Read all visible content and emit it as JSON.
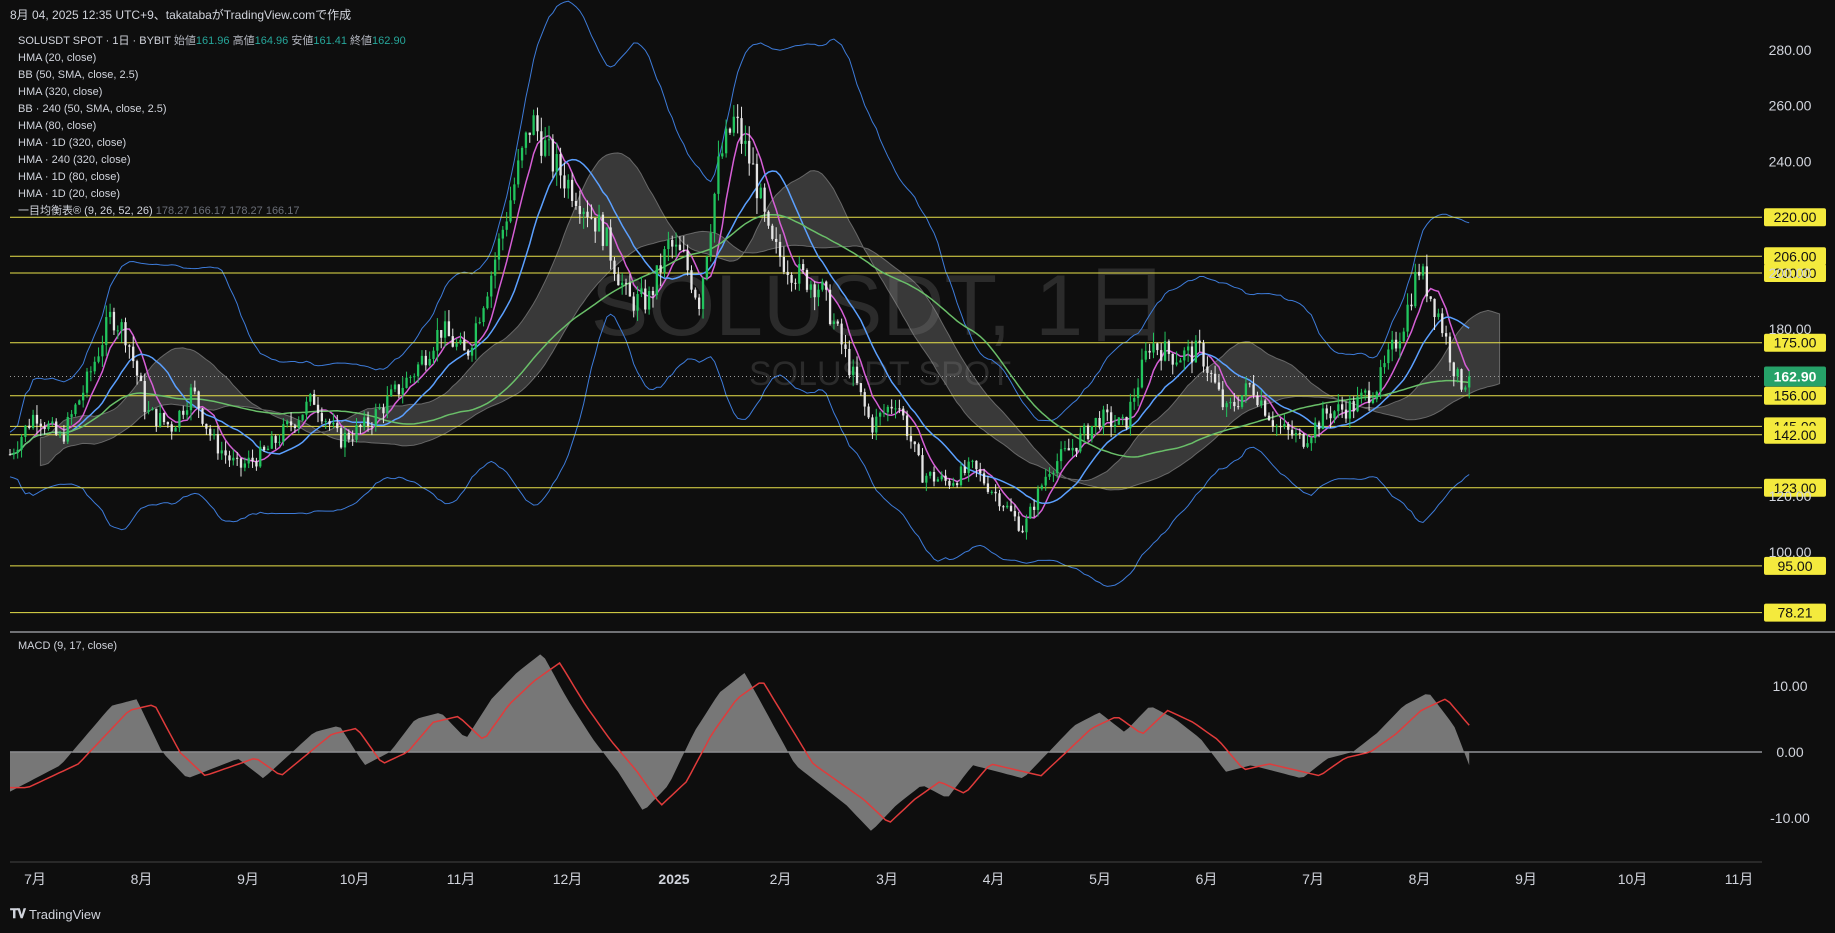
{
  "header": {
    "timestamp": "8月 04, 2025 12:35 UTC+9、takatabaがTradingView.comで作成"
  },
  "legend": {
    "symbol": "SOLUSDT SPOT · 1日 · BYBIT",
    "ohlc": [
      {
        "label": "始値",
        "value": "161.96"
      },
      {
        "label": "高値",
        "value": "164.96"
      },
      {
        "label": "安値",
        "value": "161.41"
      },
      {
        "label": "終値",
        "value": "162.90"
      }
    ],
    "indicators": [
      "HMA (20, close)",
      "BB (50, SMA, close, 2.5)",
      "HMA (320, close)",
      "BB · 240 (50, SMA, close, 2.5)",
      "HMA (80, close)",
      "HMA · 1D (320, close)",
      "HMA · 240 (320, close)",
      "HMA · 1D (80, close)",
      "HMA · 1D (20, close)"
    ],
    "ichimoku": {
      "name": "一目均衡表® (9, 26, 52, 26)",
      "values": [
        "178.27",
        "166.17",
        "178.27",
        "166.17"
      ]
    }
  },
  "watermark": {
    "title": "SOLUSDT, 1日",
    "subtitle": "SOLUSDT SPOT"
  },
  "macd_label": "MACD (9, 17, close)",
  "footer": {
    "brand": "TradingView",
    "logo": "tradingview-logo-icon"
  },
  "colors": {
    "background": "#0e0e0e",
    "up_candle": "#22c55e",
    "down_candle": "#e6e6e6",
    "level_line": "#e8e14a",
    "level_label_bg": "#f4ea3d",
    "price_label_bg": "#26a269",
    "hma_fast": "#d65fd6",
    "hma_mid": "#5ba0ff",
    "hma_slow": "#6abf69",
    "bb": "#3d7bd9",
    "cloud": "#8a8a8a",
    "macd_hist": "#8a8a8a",
    "macd_signal": "#e03b3b"
  },
  "chart_data": {
    "type": "candlestick",
    "title": "SOLUSDT, 1日",
    "price_axis_ticks": [
      "280.00",
      "260.00",
      "240.00",
      "200.00",
      "180.00",
      "120.00",
      "100.00"
    ],
    "ylim": [
      72,
      290
    ],
    "time_axis_labels": [
      "7月",
      "8月",
      "9月",
      "10月",
      "11月",
      "12月",
      "2025",
      "2月",
      "3月",
      "4月",
      "5月",
      "6月",
      "7月",
      "8月",
      "9月",
      "10月",
      "11月"
    ],
    "horizontal_levels": [
      "220.00",
      "206.00",
      "200.00",
      "175.00",
      "156.00",
      "145.00",
      "142.00",
      "123.00",
      "95.00",
      "78.21"
    ],
    "last_price": "162.90",
    "price_path": [
      {
        "x": 0,
        "p": 135
      },
      {
        "x": 0.5,
        "p": 150
      },
      {
        "x": 1,
        "p": 140
      },
      {
        "x": 1.5,
        "p": 160
      },
      {
        "x": 2,
        "p": 185
      },
      {
        "x": 2.3,
        "p": 178
      },
      {
        "x": 2.7,
        "p": 150
      },
      {
        "x": 3.2,
        "p": 145
      },
      {
        "x": 3.6,
        "p": 158
      },
      {
        "x": 4.0,
        "p": 140
      },
      {
        "x": 4.5,
        "p": 130
      },
      {
        "x": 5.0,
        "p": 135
      },
      {
        "x": 5.5,
        "p": 145
      },
      {
        "x": 6.0,
        "p": 155
      },
      {
        "x": 6.5,
        "p": 140
      },
      {
        "x": 7.0,
        "p": 145
      },
      {
        "x": 7.5,
        "p": 155
      },
      {
        "x": 8.0,
        "p": 165
      },
      {
        "x": 8.5,
        "p": 180
      },
      {
        "x": 9.0,
        "p": 170
      },
      {
        "x": 9.5,
        "p": 200
      },
      {
        "x": 10.0,
        "p": 235
      },
      {
        "x": 10.3,
        "p": 255
      },
      {
        "x": 10.7,
        "p": 240
      },
      {
        "x": 11.2,
        "p": 228
      },
      {
        "x": 11.7,
        "p": 215
      },
      {
        "x": 12.2,
        "p": 190
      },
      {
        "x": 12.6,
        "p": 190
      },
      {
        "x": 13.0,
        "p": 210
      },
      {
        "x": 13.3,
        "p": 205
      },
      {
        "x": 13.6,
        "p": 190
      },
      {
        "x": 14.0,
        "p": 240
      },
      {
        "x": 14.3,
        "p": 255
      },
      {
        "x": 14.7,
        "p": 235
      },
      {
        "x": 15.0,
        "p": 210
      },
      {
        "x": 15.5,
        "p": 200
      },
      {
        "x": 16.0,
        "p": 195
      },
      {
        "x": 16.5,
        "p": 170
      },
      {
        "x": 17.0,
        "p": 145
      },
      {
        "x": 17.5,
        "p": 155
      },
      {
        "x": 18.0,
        "p": 128
      },
      {
        "x": 18.5,
        "p": 125
      },
      {
        "x": 19.0,
        "p": 130
      },
      {
        "x": 19.5,
        "p": 120
      },
      {
        "x": 20.0,
        "p": 108
      },
      {
        "x": 20.5,
        "p": 130
      },
      {
        "x": 21.0,
        "p": 138
      },
      {
        "x": 21.5,
        "p": 148
      },
      {
        "x": 22.0,
        "p": 145
      },
      {
        "x": 22.5,
        "p": 175
      },
      {
        "x": 23.0,
        "p": 170
      },
      {
        "x": 23.5,
        "p": 172
      },
      {
        "x": 24.0,
        "p": 150
      },
      {
        "x": 24.5,
        "p": 160
      },
      {
        "x": 25.0,
        "p": 145
      },
      {
        "x": 25.5,
        "p": 140
      },
      {
        "x": 26.0,
        "p": 150
      },
      {
        "x": 26.5,
        "p": 152
      },
      {
        "x": 27.0,
        "p": 160
      },
      {
        "x": 27.5,
        "p": 182
      },
      {
        "x": 27.8,
        "p": 202
      },
      {
        "x": 28.2,
        "p": 185
      },
      {
        "x": 28.6,
        "p": 160
      },
      {
        "x": 28.8,
        "p": 162.9
      }
    ],
    "macd_axis_ticks": [
      "10.00",
      "0.00",
      "-10.00"
    ],
    "macd_path": [
      {
        "x": 0,
        "v": -6
      },
      {
        "x": 1,
        "v": -2
      },
      {
        "x": 2,
        "v": 7
      },
      {
        "x": 2.5,
        "v": 8
      },
      {
        "x": 3,
        "v": 0
      },
      {
        "x": 3.5,
        "v": -4
      },
      {
        "x": 4.5,
        "v": -1
      },
      {
        "x": 5,
        "v": -4
      },
      {
        "x": 6,
        "v": 3
      },
      {
        "x": 6.5,
        "v": 4
      },
      {
        "x": 7,
        "v": -2
      },
      {
        "x": 7.5,
        "v": 0
      },
      {
        "x": 8,
        "v": 5
      },
      {
        "x": 8.5,
        "v": 6
      },
      {
        "x": 9,
        "v": 2
      },
      {
        "x": 9.5,
        "v": 8
      },
      {
        "x": 10,
        "v": 12
      },
      {
        "x": 10.5,
        "v": 15
      },
      {
        "x": 11,
        "v": 8
      },
      {
        "x": 11.5,
        "v": 2
      },
      {
        "x": 12,
        "v": -3
      },
      {
        "x": 12.5,
        "v": -9
      },
      {
        "x": 13,
        "v": -5
      },
      {
        "x": 13.5,
        "v": 3
      },
      {
        "x": 14,
        "v": 9
      },
      {
        "x": 14.5,
        "v": 12
      },
      {
        "x": 15,
        "v": 5
      },
      {
        "x": 15.5,
        "v": -2
      },
      {
        "x": 16,
        "v": -5
      },
      {
        "x": 16.5,
        "v": -8
      },
      {
        "x": 17,
        "v": -12
      },
      {
        "x": 17.5,
        "v": -8
      },
      {
        "x": 18,
        "v": -5
      },
      {
        "x": 18.5,
        "v": -7
      },
      {
        "x": 19,
        "v": -2
      },
      {
        "x": 19.5,
        "v": -3
      },
      {
        "x": 20,
        "v": -4
      },
      {
        "x": 20.5,
        "v": 0
      },
      {
        "x": 21,
        "v": 4
      },
      {
        "x": 21.5,
        "v": 6
      },
      {
        "x": 22,
        "v": 3
      },
      {
        "x": 22.5,
        "v": 7
      },
      {
        "x": 23,
        "v": 5
      },
      {
        "x": 23.5,
        "v": 2
      },
      {
        "x": 24,
        "v": -3
      },
      {
        "x": 24.5,
        "v": -2
      },
      {
        "x": 25,
        "v": -3
      },
      {
        "x": 25.5,
        "v": -4
      },
      {
        "x": 26,
        "v": -1
      },
      {
        "x": 26.5,
        "v": 0
      },
      {
        "x": 27,
        "v": 3
      },
      {
        "x": 27.5,
        "v": 7
      },
      {
        "x": 28,
        "v": 9
      },
      {
        "x": 28.5,
        "v": 4
      },
      {
        "x": 28.8,
        "v": -2
      }
    ]
  }
}
